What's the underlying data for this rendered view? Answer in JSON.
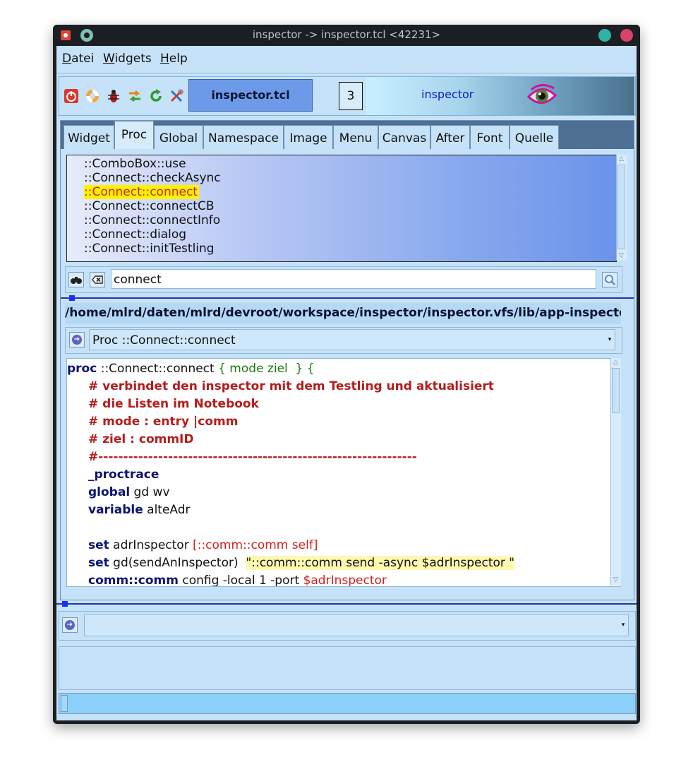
{
  "window": {
    "title": "inspector -> inspector.tcl <42231>"
  },
  "menubar": {
    "items": [
      {
        "first": "D",
        "rest": "atei"
      },
      {
        "first": "W",
        "rest": "idgets"
      },
      {
        "first": "H",
        "rest": "elp"
      }
    ]
  },
  "toolbar": {
    "icons": [
      "power-icon",
      "lifebuoy-icon",
      "bug-icon",
      "swap-arrows-icon",
      "refresh-icon",
      "tools-icon"
    ],
    "target_label": "inspector.tcl <42231>",
    "count": "3",
    "banner_text": "inspector"
  },
  "tabs": [
    "Widget",
    "Proc",
    "Global",
    "Namespace",
    "Image",
    "Menu",
    "Canvas",
    "After",
    "Font",
    "Quelle"
  ],
  "active_tab": "Proc",
  "proc_list": {
    "items": [
      "::ComboBox::use",
      "::Connect::checkAsync",
      "::Connect::connect",
      "::Connect::connectCB",
      "::Connect::connectInfo",
      "::Connect::dialog",
      "::Connect::initTestling"
    ],
    "selected": "::Connect::connect",
    "selected_color": "#fff300"
  },
  "search": {
    "value": "connect"
  },
  "path": "/home/mlrd/daten/mlrd/devroot/workspace/inspector/inspector.vfs/lib/app-inspector/con",
  "proc_select": {
    "value": "Proc ::Connect::connect"
  },
  "code": {
    "l1_kw": "proc",
    "l1_name": " ::Connect::connect",
    "l1_args": " { mode ziel  } {",
    "l2": "# verbindet den inspector mit dem Testling und aktualisiert",
    "l3": "# die Listen im Notebook",
    "l4": "# mode : entry |comm",
    "l5": "# ziel : commID",
    "l6": "#----------------------------------------------------------------",
    "l7": "_proctrace",
    "l8_kw": "global",
    "l8_rest": " gd wv",
    "l9_kw": "variable",
    "l9_rest": " alteAdr",
    "l11_kw": "set",
    "l11_rest": " adrInspector ",
    "l11_red": "[::comm::comm self]",
    "l12_kw": "set",
    "l12_rest": " gd(sendAnInspector)  ",
    "l12_str": "\"::comm::comm send -async $adrInspector \"",
    "l13_kw": "comm::comm",
    "l13_rest": " config -local 1 -port ",
    "l13_var": "$adrInspector"
  },
  "command": {
    "value": ""
  },
  "colors": {
    "accent": "#6d9ae8",
    "keyword": "#0e1470",
    "comment": "#b51c1c",
    "string_bg": "#fff8b0"
  }
}
